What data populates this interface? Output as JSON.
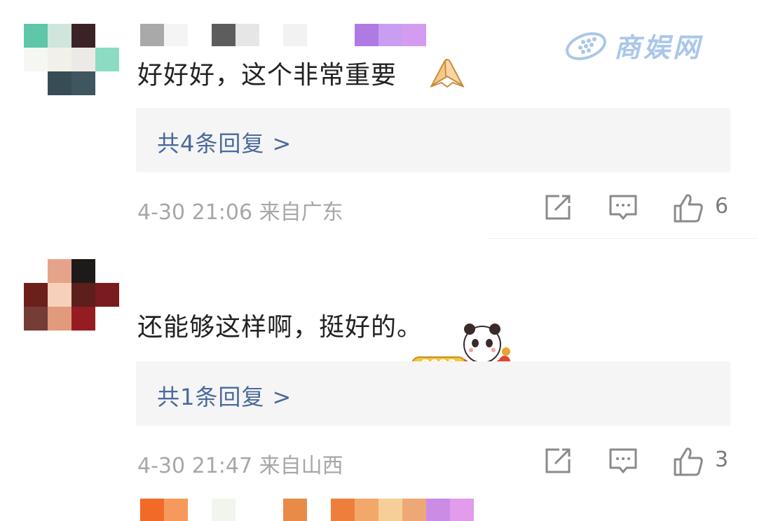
{
  "watermark": {
    "text": "商娱网"
  },
  "comments": [
    {
      "text": "好好好，这个非常重要",
      "emoji": "praying-hands",
      "reply_link": "共4条回复 >",
      "time": "4-30 21:06",
      "location": "来自广东",
      "likes": "6"
    },
    {
      "text": "还能够这样啊，挺好的。",
      "sticker": "2023 panda sticker",
      "reply_link": "共1条回复 >",
      "time": "4-30 21:47",
      "location": "来自山西",
      "likes": "3"
    }
  ],
  "colors": {
    "link": "#4a6a9c",
    "meta": "#a7a7a7",
    "reply_bg": "#f5f5f5",
    "watermark": "#aac7ea"
  }
}
